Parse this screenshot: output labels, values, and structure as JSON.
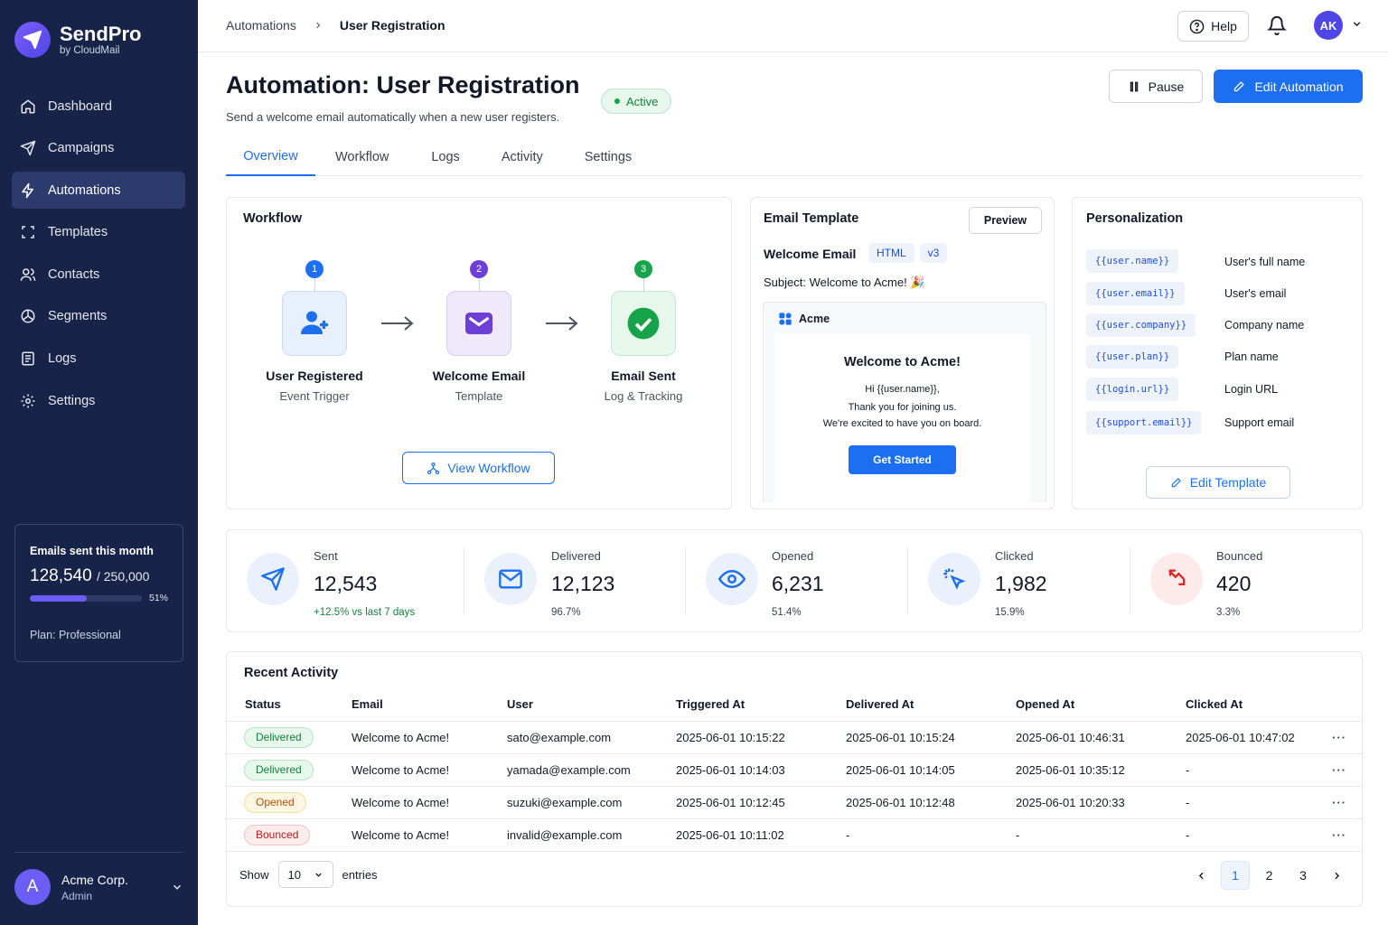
{
  "app": {
    "name": "SendPro",
    "byline": "by CloudMail"
  },
  "sidebar": {
    "items": [
      {
        "label": "Dashboard",
        "icon": "home-icon"
      },
      {
        "label": "Campaigns",
        "icon": "send-icon"
      },
      {
        "label": "Automations",
        "icon": "bolt-icon",
        "active": true
      },
      {
        "label": "Templates",
        "icon": "template-icon"
      },
      {
        "label": "Contacts",
        "icon": "users-icon"
      },
      {
        "label": "Segments",
        "icon": "segments-icon"
      },
      {
        "label": "Logs",
        "icon": "logs-icon"
      },
      {
        "label": "Settings",
        "icon": "gear-icon"
      }
    ],
    "usage": {
      "label": "Emails sent this month",
      "used": "128,540",
      "limit": "/ 250,000",
      "percent": "51%",
      "fraction": 0.51,
      "plan": "Plan: Professional"
    },
    "account": {
      "initial": "A",
      "name": "Acme Corp.",
      "role": "Admin"
    }
  },
  "topbar": {
    "breadcrumb": [
      "Automations",
      "User Registration"
    ],
    "help": "Help",
    "avatar": "AK"
  },
  "header": {
    "title": "Automation: User Registration",
    "subtitle": "Send a welcome email automatically when a new user registers.",
    "status": "Active",
    "pause": "Pause",
    "edit": "Edit Automation"
  },
  "tabs": [
    "Overview",
    "Workflow",
    "Logs",
    "Activity",
    "Settings"
  ],
  "workflow": {
    "title": "Workflow",
    "steps": [
      {
        "num": "1",
        "label": "User Registered",
        "sub": "Event Trigger"
      },
      {
        "num": "2",
        "label": "Welcome Email",
        "sub": "Template"
      },
      {
        "num": "3",
        "label": "Email Sent",
        "sub": "Log & Tracking"
      }
    ],
    "button": "View Workflow"
  },
  "template": {
    "title": "Email Template",
    "preview": "Preview",
    "name": "Welcome Email",
    "tags": [
      "HTML",
      "v3"
    ],
    "subject": "Subject: Welcome to Acme! 🎉",
    "brand": "Acme",
    "heading": "Welcome to Acme!",
    "lines": [
      "Hi {{user.name}},",
      "Thank you for joining us.",
      "We're excited to have you on board."
    ],
    "cta": "Get Started"
  },
  "personalization": {
    "title": "Personalization",
    "vars": [
      {
        "var": "{{user.name}}",
        "desc": "User's full name"
      },
      {
        "var": "{{user.email}}",
        "desc": "User's email"
      },
      {
        "var": "{{user.company}}",
        "desc": "Company name"
      },
      {
        "var": "{{user.plan}}",
        "desc": "Plan name"
      },
      {
        "var": "{{login.url}}",
        "desc": "Login URL"
      },
      {
        "var": "{{support.email}}",
        "desc": "Support email"
      }
    ],
    "button": "Edit Template"
  },
  "stats": [
    {
      "label": "Sent",
      "value": "12,543",
      "sub": "+12.5% vs last 7 days",
      "color": "#1d6ff2"
    },
    {
      "label": "Delivered",
      "value": "12,123",
      "sub": "96.7%",
      "color": "#1d6ff2"
    },
    {
      "label": "Opened",
      "value": "6,231",
      "sub": "51.4%",
      "color": "#1d6ff2"
    },
    {
      "label": "Clicked",
      "value": "1,982",
      "sub": "15.9%",
      "color": "#1d6ff2"
    },
    {
      "label": "Bounced",
      "value": "420",
      "sub": "3.3%",
      "color": "#dc2626"
    }
  ],
  "activity": {
    "title": "Recent Activity",
    "columns": [
      "Status",
      "Email",
      "User",
      "Triggered At",
      "Delivered At",
      "Opened At",
      "Clicked At"
    ],
    "rows": [
      [
        "Delivered",
        "Welcome to Acme!",
        "sato@example.com",
        "2025-06-01 10:15:22",
        "2025-06-01 10:15:24",
        "2025-06-01 10:46:31",
        "2025-06-01 10:47:02"
      ],
      [
        "Delivered",
        "Welcome to Acme!",
        "yamada@example.com",
        "2025-06-01 10:14:03",
        "2025-06-01 10:14:05",
        "2025-06-01 10:35:12",
        "-"
      ],
      [
        "Opened",
        "Welcome to Acme!",
        "suzuki@example.com",
        "2025-06-01 10:12:45",
        "2025-06-01 10:12:48",
        "2025-06-01 10:20:33",
        "-"
      ],
      [
        "Bounced",
        "Welcome to Acme!",
        "invalid@example.com",
        "2025-06-01 10:11:02",
        "-",
        "-",
        "-"
      ]
    ],
    "show": "Show",
    "page_size": "10",
    "entries": "entries",
    "pages": [
      "1",
      "2",
      "3"
    ],
    "current_page": "1"
  }
}
